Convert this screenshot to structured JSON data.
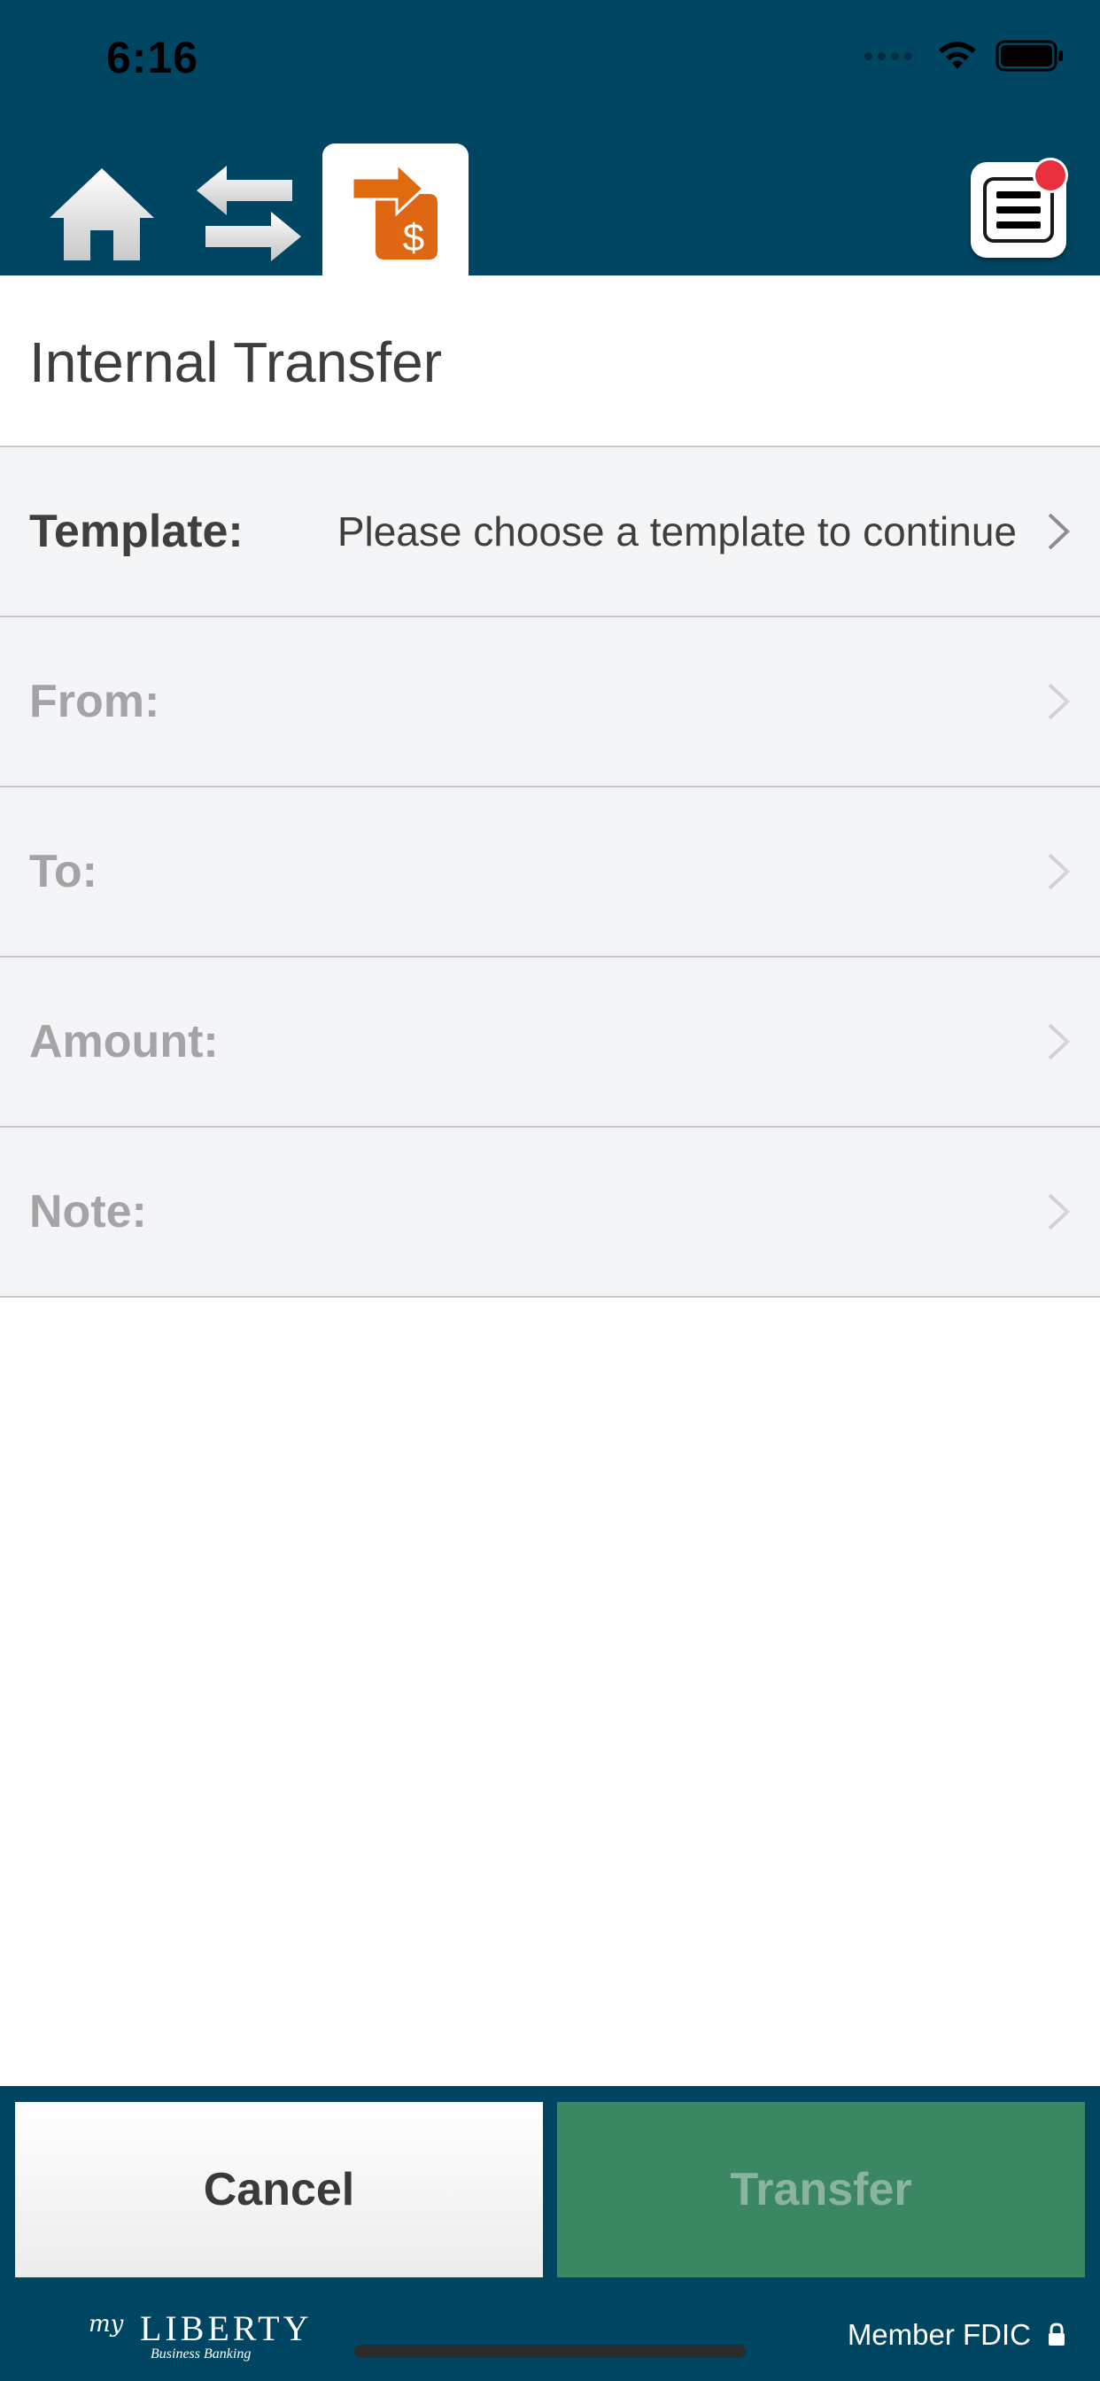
{
  "status_bar": {
    "time": "6:16"
  },
  "nav": {
    "tabs": [
      {
        "icon": "home-icon",
        "active": false
      },
      {
        "icon": "transfer-arrows-icon",
        "active": false
      },
      {
        "icon": "internal-transfer-dollar-icon",
        "active": true
      }
    ],
    "menu_icon": "hamburger-menu-icon",
    "has_notification": true
  },
  "page": {
    "title": "Internal Transfer"
  },
  "form": {
    "rows": [
      {
        "label": "Template:",
        "value": "Please choose a template to continue",
        "enabled": true
      },
      {
        "label": "From:",
        "value": "",
        "enabled": false
      },
      {
        "label": "To:",
        "value": "",
        "enabled": false
      },
      {
        "label": "Amount:",
        "value": "",
        "enabled": false
      },
      {
        "label": "Note:",
        "value": "",
        "enabled": false
      }
    ]
  },
  "actions": {
    "cancel_label": "Cancel",
    "transfer_label": "Transfer",
    "transfer_enabled": false
  },
  "footer": {
    "logo_prefix": "my",
    "logo_name": "LIBERTY",
    "logo_subtitle": "Business Banking",
    "fdic_text": "Member FDIC"
  },
  "colors": {
    "header": "#004561",
    "accent_orange": "#e0670f",
    "transfer_button": "#3c8763",
    "row_background": "#f4f5f7",
    "notification": "#e8303e"
  }
}
